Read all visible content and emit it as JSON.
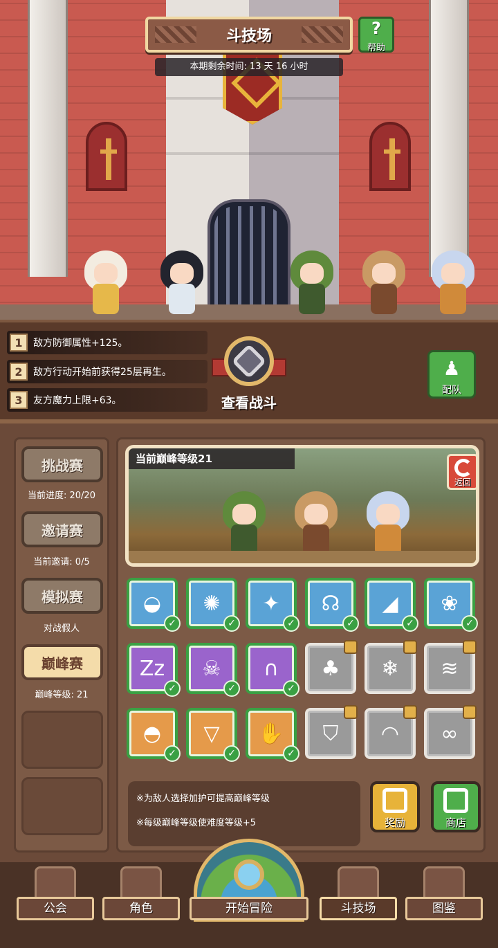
{
  "header": {
    "title": "斗技场",
    "help_label": "帮助",
    "help_icon": "?",
    "time_remaining": "本期剩余时间: 13 天 16 小时"
  },
  "modifiers": [
    {
      "num": "1",
      "text": "敌方防御属性+125。"
    },
    {
      "num": "2",
      "text": "敌方行动开始前获得25层再生。"
    },
    {
      "num": "3",
      "text": "友方魔力上限+63。"
    }
  ],
  "view_battle": {
    "label": "查看战斗"
  },
  "team": {
    "label": "配队"
  },
  "modes": [
    {
      "label": "挑战赛",
      "sub": "当前进度: 20/20",
      "active": false
    },
    {
      "label": "邀请赛",
      "sub": "当前邀请: 0/5",
      "active": false
    },
    {
      "label": "模拟赛",
      "sub": "对战假人",
      "active": false
    },
    {
      "label": "巅峰赛",
      "sub": "巅峰等级: 21",
      "active": true
    }
  ],
  "preview": {
    "peak_level": "当前巅峰等级21",
    "back_label": "返回"
  },
  "buffs": [
    {
      "icon": "slime-icon",
      "glyph": "◒",
      "tone": "blue",
      "state": "checked"
    },
    {
      "icon": "gear-icon",
      "glyph": "✺",
      "tone": "blue",
      "state": "checked"
    },
    {
      "icon": "sparkle-icon",
      "glyph": "✦",
      "tone": "blue",
      "state": "checked"
    },
    {
      "icon": "halo-icon",
      "glyph": "☊",
      "tone": "blue",
      "state": "checked"
    },
    {
      "icon": "blade-icon",
      "glyph": "◢",
      "tone": "blue",
      "state": "checked"
    },
    {
      "icon": "paw-icon",
      "glyph": "❀",
      "tone": "blue",
      "state": "checked"
    },
    {
      "icon": "sleep-icon",
      "glyph": "Zz",
      "tone": "purple",
      "state": "checked"
    },
    {
      "icon": "skull-icon",
      "glyph": "☠",
      "tone": "purple",
      "state": "checked"
    },
    {
      "icon": "tombstone-icon",
      "glyph": "∩",
      "tone": "purple",
      "state": "checked"
    },
    {
      "icon": "tree-icon",
      "glyph": "♣",
      "tone": "grey",
      "state": "locked"
    },
    {
      "icon": "snowflake-icon",
      "glyph": "❄",
      "tone": "grey",
      "state": "locked"
    },
    {
      "icon": "wave-icon",
      "glyph": "≋",
      "tone": "grey",
      "state": "locked"
    },
    {
      "icon": "shell-icon",
      "glyph": "◓",
      "tone": "orange",
      "state": "checked"
    },
    {
      "icon": "shield-badge-icon",
      "glyph": "▽",
      "tone": "orange",
      "state": "checked"
    },
    {
      "icon": "claw-icon",
      "glyph": "✋",
      "tone": "orange",
      "state": "checked"
    },
    {
      "icon": "shield-icon",
      "glyph": "⛉",
      "tone": "grey",
      "state": "locked"
    },
    {
      "icon": "arch-icon",
      "glyph": "◠",
      "tone": "grey",
      "state": "locked"
    },
    {
      "icon": "infinity-icon",
      "glyph": "∞",
      "tone": "grey",
      "state": "locked"
    }
  ],
  "info": {
    "line1": "※为敌人选择加护可提高巅峰等级",
    "line2": "※每级巅峰等级使难度等级+5"
  },
  "actions": {
    "reward_label": "奖励",
    "shop_label": "商店"
  },
  "nav": {
    "guild": "公会",
    "character": "角色",
    "adventure": "开始冒险",
    "arena": "斗技场",
    "codex": "图鉴"
  },
  "colors": {
    "panel": "#6b4a39",
    "green": "#4fae4b",
    "gold": "#e7b339",
    "red": "#d84a3a"
  }
}
